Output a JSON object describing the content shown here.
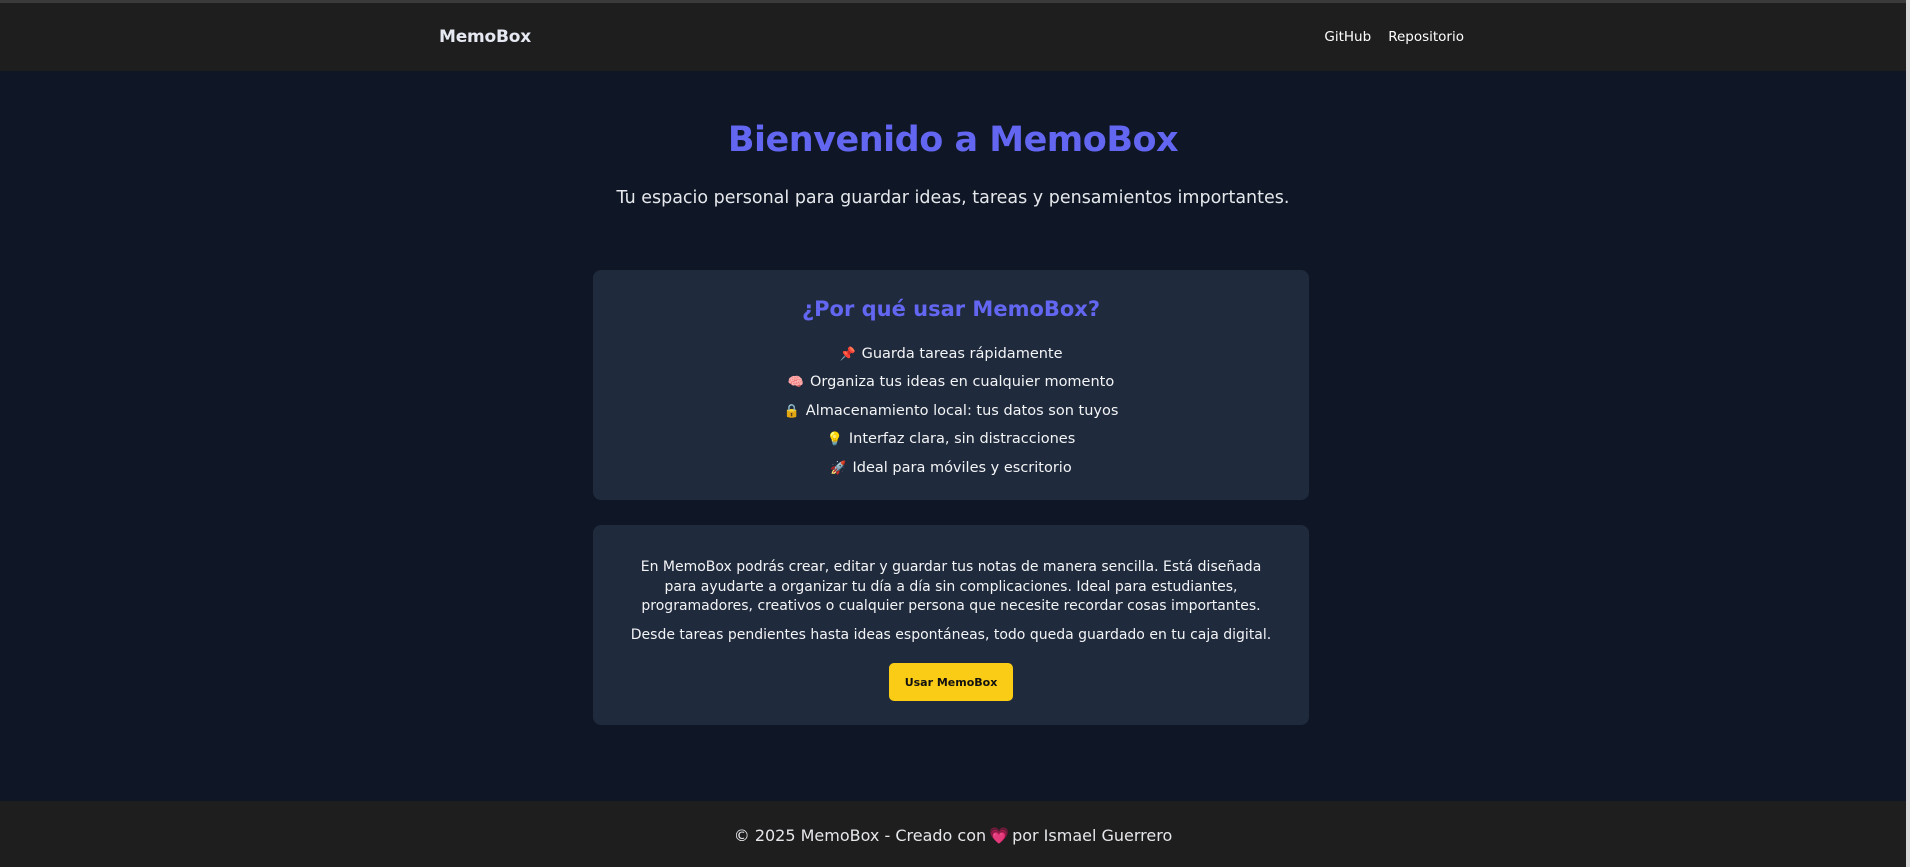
{
  "navbar": {
    "brand": "MemoBox",
    "links": [
      "GitHub",
      "Repositorio"
    ]
  },
  "hero": {
    "title": "Bienvenido a MemoBox",
    "subtitle": "Tu espacio personal para guardar ideas, tareas y pensamientos importantes."
  },
  "features": {
    "title": "¿Por qué usar MemoBox?",
    "items": [
      {
        "icon": "📌",
        "icon_name": "pushpin-icon",
        "label": "Guarda tareas rápidamente"
      },
      {
        "icon": "🧠",
        "icon_name": "brain-icon",
        "label": "Organiza tus ideas en cualquier momento"
      },
      {
        "icon": "🔒",
        "icon_name": "lock-icon",
        "label": "Almacenamiento local: tus datos son tuyos"
      },
      {
        "icon": "💡",
        "icon_name": "lightbulb-icon",
        "label": "Interfaz clara, sin distracciones"
      },
      {
        "icon": "🚀",
        "icon_name": "rocket-icon",
        "label": "Ideal para móviles y escritorio"
      }
    ]
  },
  "about": {
    "paragraph1": "En MemoBox podrás crear, editar y guardar tus notas de manera sencilla. Está diseñada para ayudarte a organizar tu día a día sin complicaciones. Ideal para estudiantes, programadores, creativos o cualquier persona que necesite recordar cosas importantes.",
    "paragraph2": "Desde tareas pendientes hasta ideas espontáneas, todo queda guardado en tu caja digital.",
    "cta_label": "Usar MemoBox"
  },
  "footer": {
    "prefix": "© 2025 MemoBox - Creado con",
    "heart": "💗",
    "suffix": "por Ismael Guerrero"
  },
  "colors": {
    "background": "#0f1727",
    "navbar": "#1e1e1e",
    "card": "#1f2a3c",
    "accent": "#6366f1",
    "button": "#facc15"
  }
}
